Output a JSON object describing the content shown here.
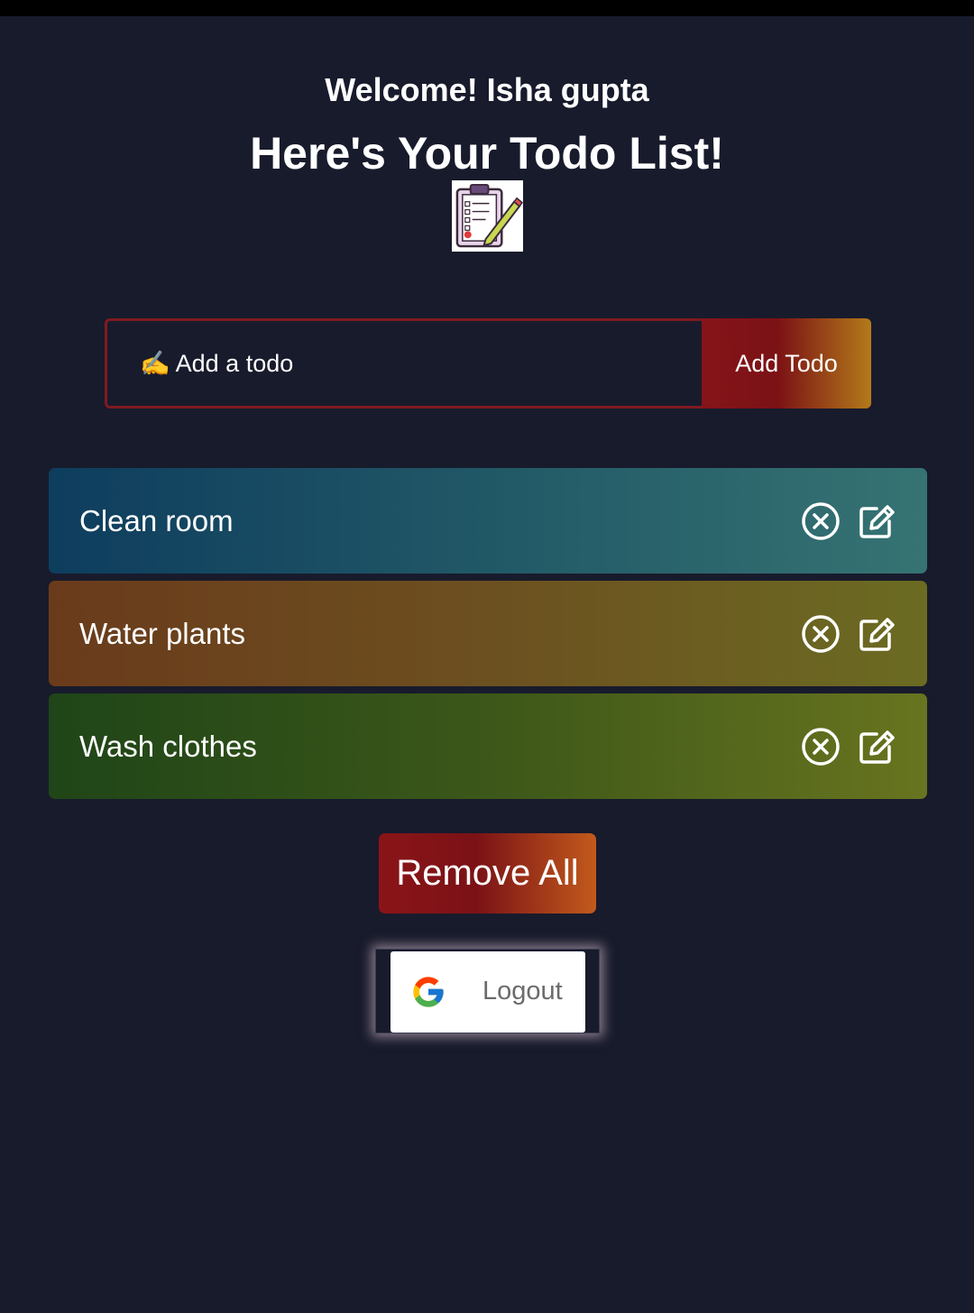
{
  "header": {
    "welcome": "Welcome! Isha gupta",
    "title": "Here's Your Todo List!",
    "illustration": "clipboard-pencil-icon"
  },
  "add_form": {
    "placeholder": "✍️ Add a todo",
    "value": "",
    "button_label": "Add Todo"
  },
  "todos": [
    {
      "text": "Clean room",
      "delete_icon": "circle-x-icon",
      "edit_icon": "edit-icon"
    },
    {
      "text": "Water plants",
      "delete_icon": "circle-x-icon",
      "edit_icon": "edit-icon"
    },
    {
      "text": "Wash clothes",
      "delete_icon": "circle-x-icon",
      "edit_icon": "edit-icon"
    }
  ],
  "actions": {
    "remove_all_label": "Remove All",
    "logout_label": "Logout",
    "logout_icon": "google-icon"
  },
  "colors": {
    "background": "#181b2c",
    "accent_red": "#7b1215",
    "accent_orange": "#b37a1a",
    "todo_1": "#215866",
    "todo_2": "#6c5020",
    "todo_3": "#3c5719"
  }
}
